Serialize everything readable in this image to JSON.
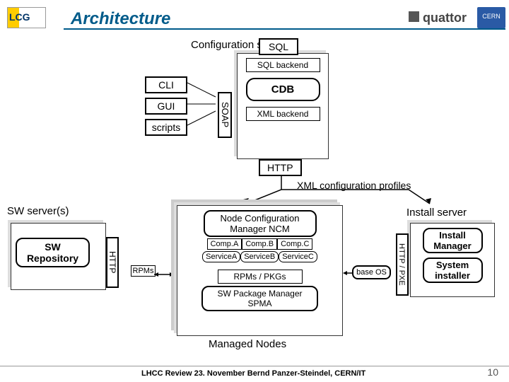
{
  "title": "Architecture",
  "logos": {
    "lcg": "LCG",
    "quattor": "quattor",
    "cern": "CERN"
  },
  "config_server": {
    "label": "Configuration server",
    "sql_tab": "SQL",
    "sql_backend": "SQL backend",
    "cdb": "CDB",
    "xml_backend": "XML backend",
    "http_tab": "HTTP"
  },
  "clients": {
    "cli": "CLI",
    "gui": "GUI",
    "scripts": "scripts",
    "soap": "SOAP"
  },
  "xml_profiles": "XML configuration profiles",
  "sw_servers": {
    "label": "SW server(s)",
    "repo": "SW Repository",
    "http": "HTTP",
    "rpms": "RPMs"
  },
  "managed_nodes": {
    "label": "Managed Nodes",
    "ncm": "Node Configuration Manager NCM",
    "comps": [
      "Comp.A",
      "Comp.B",
      "Comp.C"
    ],
    "services": [
      "ServiceA",
      "ServiceB",
      "ServiceC"
    ],
    "rpms_pkgs": "RPMs / PKGs",
    "spma": "SW Package Manager SPMA"
  },
  "base_os": "base OS",
  "install_server": {
    "label": "Install server",
    "install_mgr": "Install Manager",
    "sys_inst": "System installer",
    "http_pxe": "HTTP / PXE"
  },
  "footer": "LHCC Review 23. November   Bernd Panzer-Steindel,  CERN/IT",
  "page": "10"
}
